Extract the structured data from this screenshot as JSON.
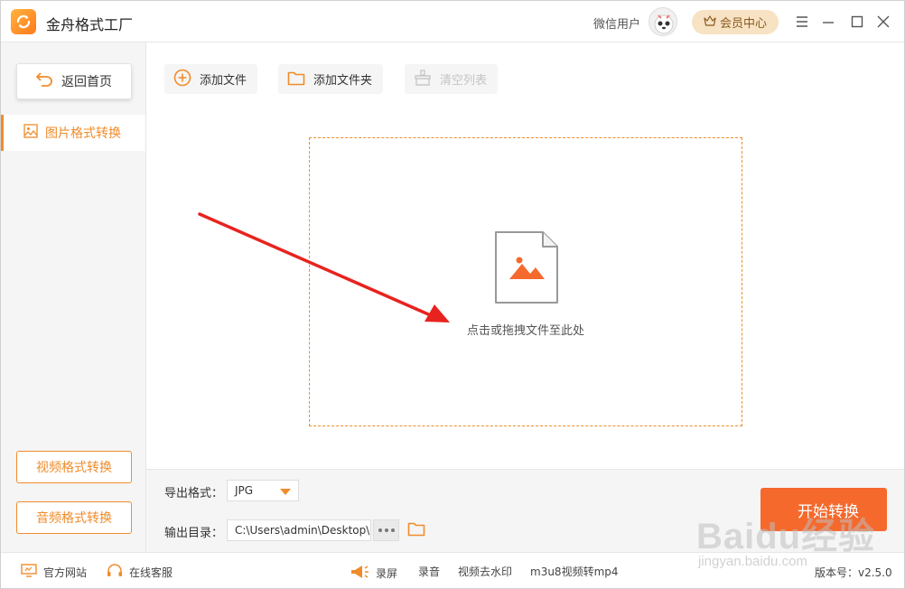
{
  "app": {
    "title": "金舟格式工厂"
  },
  "header": {
    "user_name": "微信用户",
    "vip_label": "会员中心"
  },
  "sidebar": {
    "back_label": "返回首页",
    "active_item": "图片格式转换",
    "video_btn": "视频格式转换",
    "audio_btn": "音频格式转换"
  },
  "toolbar": {
    "add_file": "添加文件",
    "add_folder": "添加文件夹",
    "clear_list": "清空列表"
  },
  "dropzone": {
    "hint": "点击或拖拽文件至此处"
  },
  "output": {
    "format_label": "导出格式：",
    "format_value": "JPG",
    "dir_label": "输出目录：",
    "dir_value": "C:\\Users\\admin\\Desktop\\"
  },
  "start_button": "开始转换",
  "statusbar": {
    "website": "官方网站",
    "service": "在线客服",
    "record_screen": "录屏",
    "record_audio": "录音",
    "remove_watermark": "视频去水印",
    "m3u8": "m3u8视频转mp4",
    "version": "版本号：v2.5.0"
  },
  "watermark": {
    "main": "Baidu经验",
    "sub": "jingyan.baidu.com"
  },
  "colors": {
    "accent": "#f08c2b",
    "start": "#f5692d",
    "arrow": "#e8231f",
    "vip_bg": "#f7e2c4"
  },
  "icons": [
    "app-logo-icon",
    "crown-icon",
    "menu-icon",
    "minimize-icon",
    "maximize-icon",
    "close-icon",
    "back-arrow-icon",
    "image-icon",
    "plus-circle-icon",
    "folder-icon",
    "basket-icon",
    "image-file-icon",
    "monitor-icon",
    "headset-icon",
    "megaphone-icon"
  ]
}
